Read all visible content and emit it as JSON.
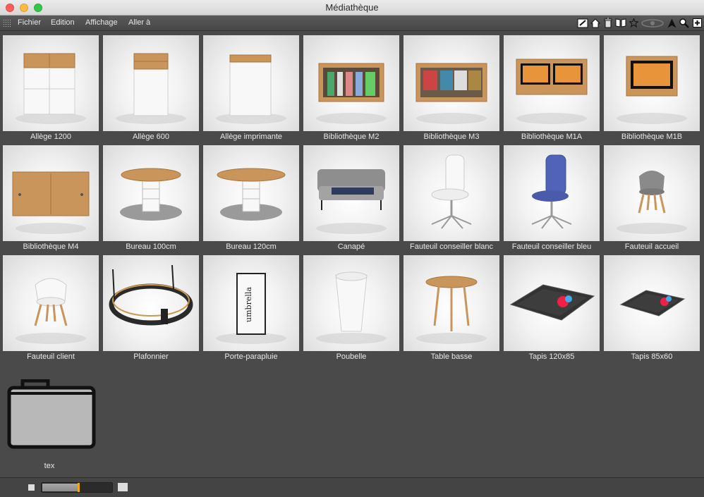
{
  "window": {
    "title": "Médiathèque"
  },
  "menu": {
    "items": [
      {
        "label": "Fichier"
      },
      {
        "label": "Edition"
      },
      {
        "label": "Affichage"
      },
      {
        "label": "Aller à"
      }
    ]
  },
  "toolbar": {
    "icons": [
      "edit-icon",
      "home-icon",
      "trash-icon",
      "book-icon",
      "star-icon",
      "eye-icon",
      "arrow-icon",
      "search-icon",
      "add-icon"
    ]
  },
  "grid": {
    "items": [
      {
        "label": "Allège 1200",
        "icon": "cabinet-wide"
      },
      {
        "label": "Allège 600",
        "icon": "cabinet-narrow"
      },
      {
        "label": "Allège imprimante",
        "icon": "cabinet-printer"
      },
      {
        "label": "Bibliothèque M2",
        "icon": "shelf-books"
      },
      {
        "label": "Bibliothèque M3",
        "icon": "shelf-magazines"
      },
      {
        "label": "Bibliothèque M1A",
        "icon": "shelf-screens"
      },
      {
        "label": "Bibliothèque M1B",
        "icon": "shelf-screen"
      },
      {
        "label": "Bibliothèque M4",
        "icon": "sideboard"
      },
      {
        "label": "Bureau 100cm",
        "icon": "round-table"
      },
      {
        "label": "Bureau 120cm",
        "icon": "round-table-wide"
      },
      {
        "label": "Canapé",
        "icon": "sofa"
      },
      {
        "label": "Fauteuil  conseiller blanc",
        "icon": "office-chair-white"
      },
      {
        "label": "Fauteuil  conseiller bleu",
        "icon": "office-chair-blue"
      },
      {
        "label": "Fauteuil accueil",
        "icon": "shell-chair-grey"
      },
      {
        "label": "Fauteuil client",
        "icon": "shell-chair-white"
      },
      {
        "label": "Plafonnier",
        "icon": "ring-lamp"
      },
      {
        "label": "Porte-parapluie",
        "icon": "umbrella-stand"
      },
      {
        "label": "Poubelle",
        "icon": "bin"
      },
      {
        "label": "Table basse",
        "icon": "coffee-table"
      },
      {
        "label": "Tapis 120x85",
        "icon": "rug-large"
      },
      {
        "label": "Tapis 85x60",
        "icon": "rug-small"
      }
    ]
  },
  "folder": {
    "label": "tex"
  },
  "zoom": {
    "level": 0.5
  },
  "colors": {
    "accent": "#f2a900",
    "background": "#4a4a4a"
  }
}
